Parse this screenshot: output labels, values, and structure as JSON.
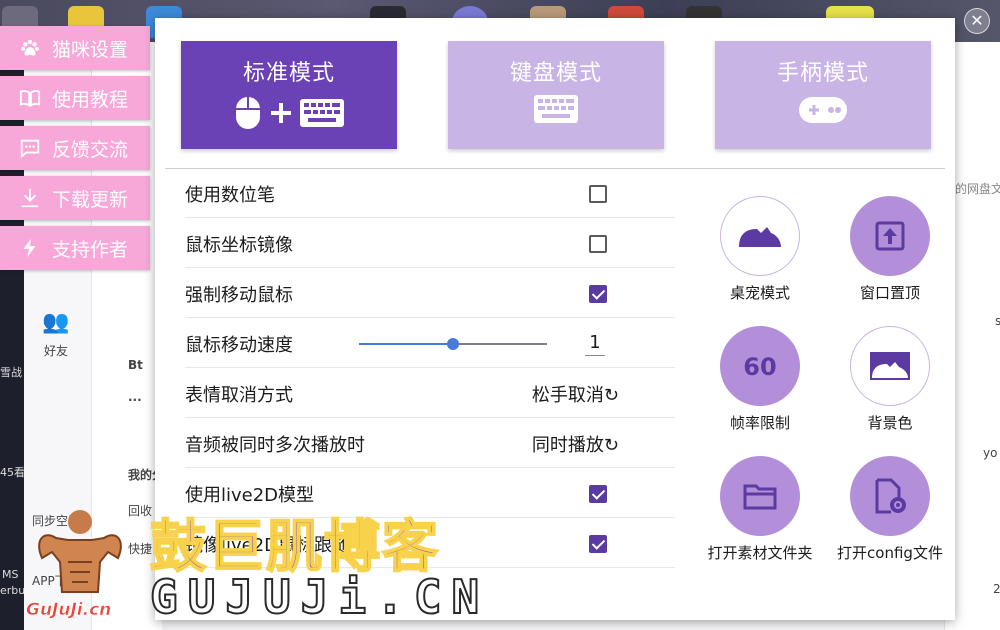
{
  "left_menu": [
    {
      "label": "猫咪设置",
      "icon": "paw-icon"
    },
    {
      "label": "使用教程",
      "icon": "book-icon"
    },
    {
      "label": "反馈交流",
      "icon": "chat-icon"
    },
    {
      "label": "下载更新",
      "icon": "download-icon"
    },
    {
      "label": "支持作者",
      "icon": "lightning-icon"
    }
  ],
  "modes": [
    {
      "label": "标准模式",
      "active": true,
      "icon": "mouse-keyboard-icon"
    },
    {
      "label": "键盘模式",
      "active": false,
      "icon": "keyboard-icon"
    },
    {
      "label": "手柄模式",
      "active": false,
      "icon": "gamepad-icon"
    }
  ],
  "settings": {
    "digital_pen": {
      "label": "使用数位笔",
      "checked": false
    },
    "mouse_mirror": {
      "label": "鼠标坐标镜像",
      "checked": false
    },
    "force_move": {
      "label": "强制移动鼠标",
      "checked": true
    },
    "mouse_speed": {
      "label": "鼠标移动速度",
      "value": "1",
      "fraction": 0.5
    },
    "emote_cancel": {
      "label": "表情取消方式",
      "value": "松手取消"
    },
    "audio_multi": {
      "label": "音频被同时多次播放时",
      "value": "同时播放"
    },
    "live2d": {
      "label": "使用live2D模型",
      "checked": true
    },
    "live2d_mirror": {
      "label": "镜像live2D鼠标跟随",
      "checked": true
    }
  },
  "functions": [
    {
      "label": "桌宠模式",
      "icon": "cat-icon"
    },
    {
      "label": "窗口置顶",
      "icon": "pin-top-icon"
    },
    {
      "label": "帧率限制",
      "icon": "fps-60-icon"
    },
    {
      "label": "背景色",
      "icon": "background-icon"
    },
    {
      "label": "打开素材文件夹",
      "icon": "folder-icon"
    },
    {
      "label": "打开config文件",
      "icon": "file-settings-icon"
    }
  ],
  "background": {
    "nav_friends": "好友",
    "nav_sync": "同步空间",
    "nav_app": "APP下载",
    "list_items": [
      "Bt",
      "...",
      "我的分",
      "回收",
      "快捷"
    ],
    "right_snippet": "的网盘文",
    "right_s": "s",
    "right_yo": "yo",
    "right_2": "2",
    "left_edge_1": "雪战",
    "left_edge_2": "45看",
    "left_edge_3": "MS",
    "left_edge_4": "erbu"
  },
  "watermark": {
    "cn": "鼓巨肌博客",
    "en": "GUJUJi.CN",
    "small": "GuJuJi.cn"
  },
  "colors": {
    "mode_active": "#6b42b5",
    "mode_inactive": "#c9b4e6",
    "menu_pink": "#f7a8d9",
    "checkbox_on": "#5b3aa1",
    "circle_fill": "#b48fd9",
    "slider": "#4a7ad8"
  }
}
